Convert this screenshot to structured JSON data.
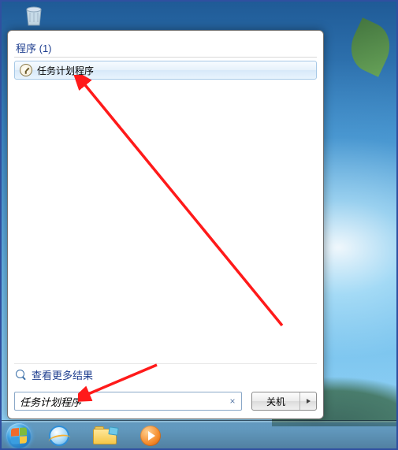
{
  "startMenu": {
    "sectionHeader": "程序 (1)",
    "resultLabel": "任务计划程序",
    "seeMore": "查看更多结果",
    "searchValue": "任务计划程序",
    "shutdownLabel": "关机"
  }
}
